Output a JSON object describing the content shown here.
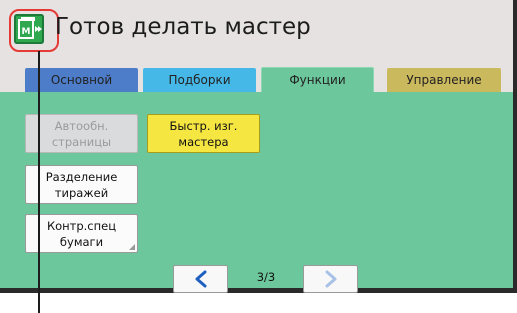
{
  "header": {
    "title": "Готов делать мастер",
    "icon": "master-ready-icon"
  },
  "tabs": [
    {
      "label": "Основной",
      "color": "#4d7cc8"
    },
    {
      "label": "Подборки",
      "color": "#46b8e8"
    },
    {
      "label": "Функции",
      "color": "#6cc89c",
      "active": true
    },
    {
      "label": "Управление",
      "color": "#cbb95d"
    }
  ],
  "buttons": {
    "auto_pages": "Автообн. страницы",
    "fast_master": "Быстр. изг. мастера",
    "job_separation": "Разделение тиражей",
    "special_paper": "Контр.спец бумаги"
  },
  "pagination": {
    "current": "3/3"
  },
  "colors": {
    "accent_green": "#6cc89c",
    "highlight": "#e53a35",
    "button_yellow": "#f5e642"
  }
}
